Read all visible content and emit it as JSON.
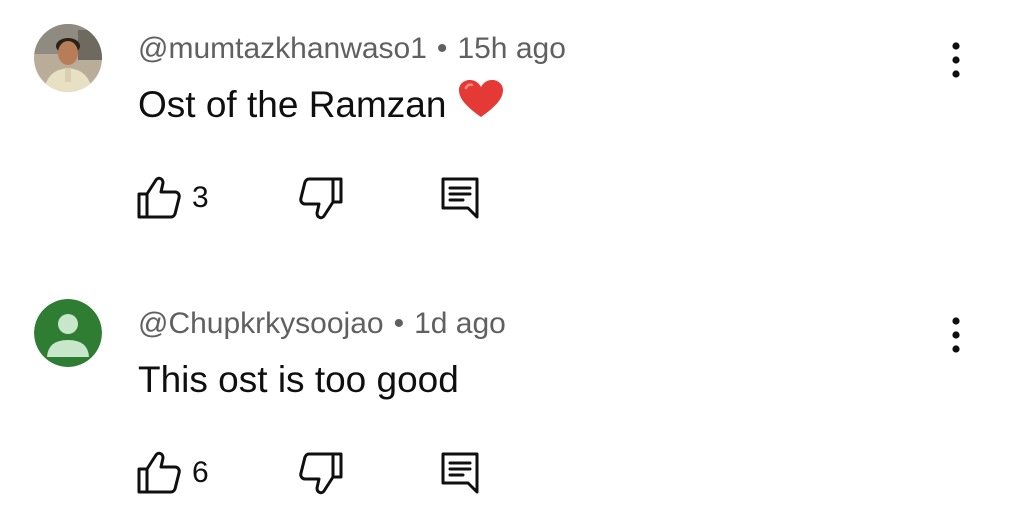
{
  "comments": [
    {
      "handle": "@mumtazkhanwaso1",
      "separator": "•",
      "time": "15h ago",
      "text": "Ost of the Ramzan",
      "emoji_icon": "red-heart-emoji",
      "likes": "3",
      "avatar_icon": "user-photo-avatar"
    },
    {
      "handle": "@Chupkrkysoojao",
      "separator": "•",
      "time": "1d ago",
      "text": "This ost is too good",
      "likes": "6",
      "avatar_icon": "default-person-avatar",
      "avatar_color": "#2e7d32"
    }
  ],
  "icons": {
    "like": "thumbs-up-icon",
    "dislike": "thumbs-down-icon",
    "reply": "reply-comment-icon",
    "more": "more-vertical-icon"
  },
  "colors": {
    "meta_text": "#606060",
    "body_text": "#0f0f0f",
    "heart": "#e53935"
  }
}
